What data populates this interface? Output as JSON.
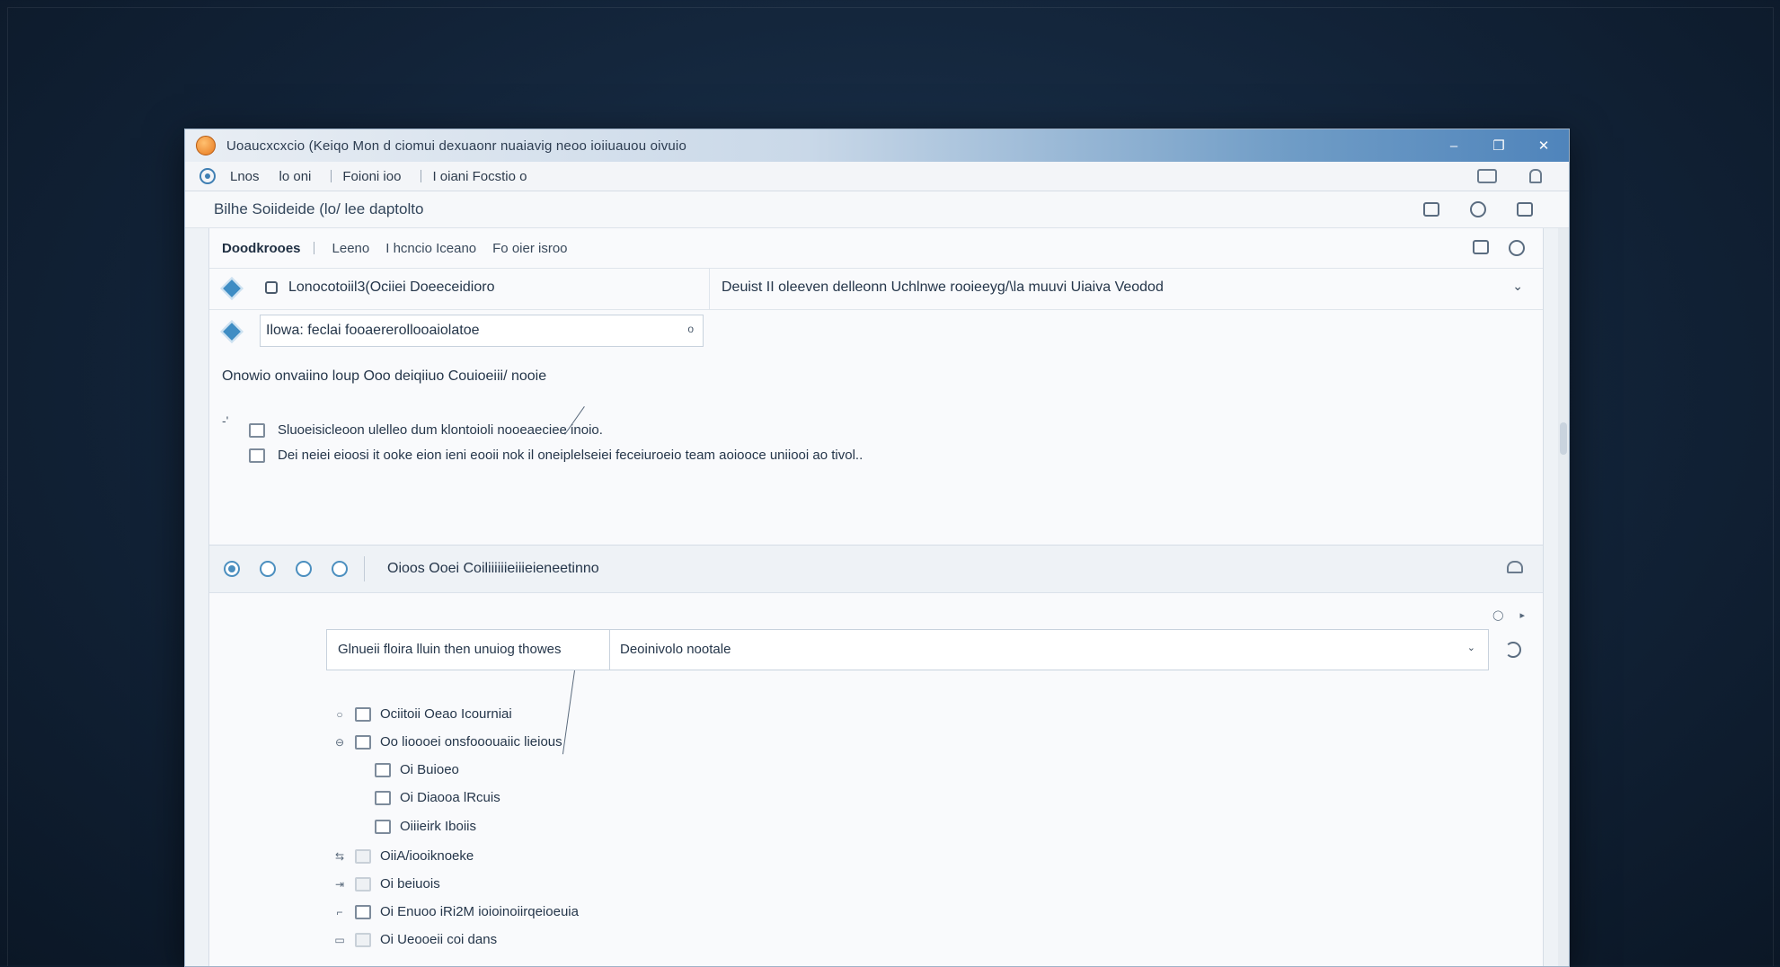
{
  "window": {
    "title": "Uoaucxcxcio (Keiqo Mon d ciomui dexuaonr nuaiavig neoo ioiiuauou oivuio",
    "controls": [
      "–",
      "❐",
      "✕"
    ]
  },
  "menubar": {
    "items": [
      "Lnos",
      "lo oni",
      "Foioni ioo",
      "I oiani Focstio o"
    ]
  },
  "pathbar": {
    "text": "Bilhe Soiideide (lo/ lee daptolto"
  },
  "tabs": {
    "items": [
      "Doodkrooes",
      "Leeno",
      "I hcncio Iceano",
      "Fo oier isroo"
    ]
  },
  "row1": {
    "left_label": "Lonocotoiil3(Ociiei Doeeceidioro",
    "right_label": "Deuist II oleeven delleonn Uchlnwe rooieeyg/\\la muuvi Uiaiva Veodod",
    "chevron": "⌄"
  },
  "search": {
    "value": "Ilowa: feclai fooaererollooaiolatoe",
    "clear_icon": "o"
  },
  "question": {
    "text": "Onowio onvaiino loup Ooo deiqiiuo Couioeiii/ nooie",
    "prefix_mark": "-'",
    "options": [
      "Sluoeisicleoon ulelleo dum klontoioli nooeaeciee inoio.",
      "Dei neiei eioosi it ooke eion ieni eooii nok il oneiplelseiei feceiuroeio team aoiooce uniiooi ao tivol.."
    ]
  },
  "radio_bar": {
    "count": 4,
    "selected_index": 0,
    "label": "Oioos Ooei Coiliiiiiieiiieieneetinno"
  },
  "filter": {
    "left_label": "Glnueii floira lluin then unuiog thowes",
    "right_label": "Deoinivolo nootale",
    "chevron": "⌄"
  },
  "tree": {
    "items": [
      {
        "label": "Ociitoii Oeao Icourniai",
        "expander": "○"
      },
      {
        "label": "Oo lioooei onsfooouaiic lieious",
        "expander": "⊖"
      },
      {
        "label": "Oi Buioeo",
        "expander": ""
      },
      {
        "label": "Oi Diaooa lRcuis",
        "expander": ""
      },
      {
        "label": "Oiiieirk Iboiis",
        "expander": ""
      },
      {
        "label": "OiiA/iooiknoeke",
        "expander": "⇆"
      },
      {
        "label": "Oi beiuois",
        "expander": "⇥"
      },
      {
        "label": "Oi Enuoo iRi2M ioioinoiirqeioeuia",
        "expander": "⌐"
      },
      {
        "label": "Oi Ueooeii coi dans",
        "expander": "▭"
      }
    ]
  }
}
